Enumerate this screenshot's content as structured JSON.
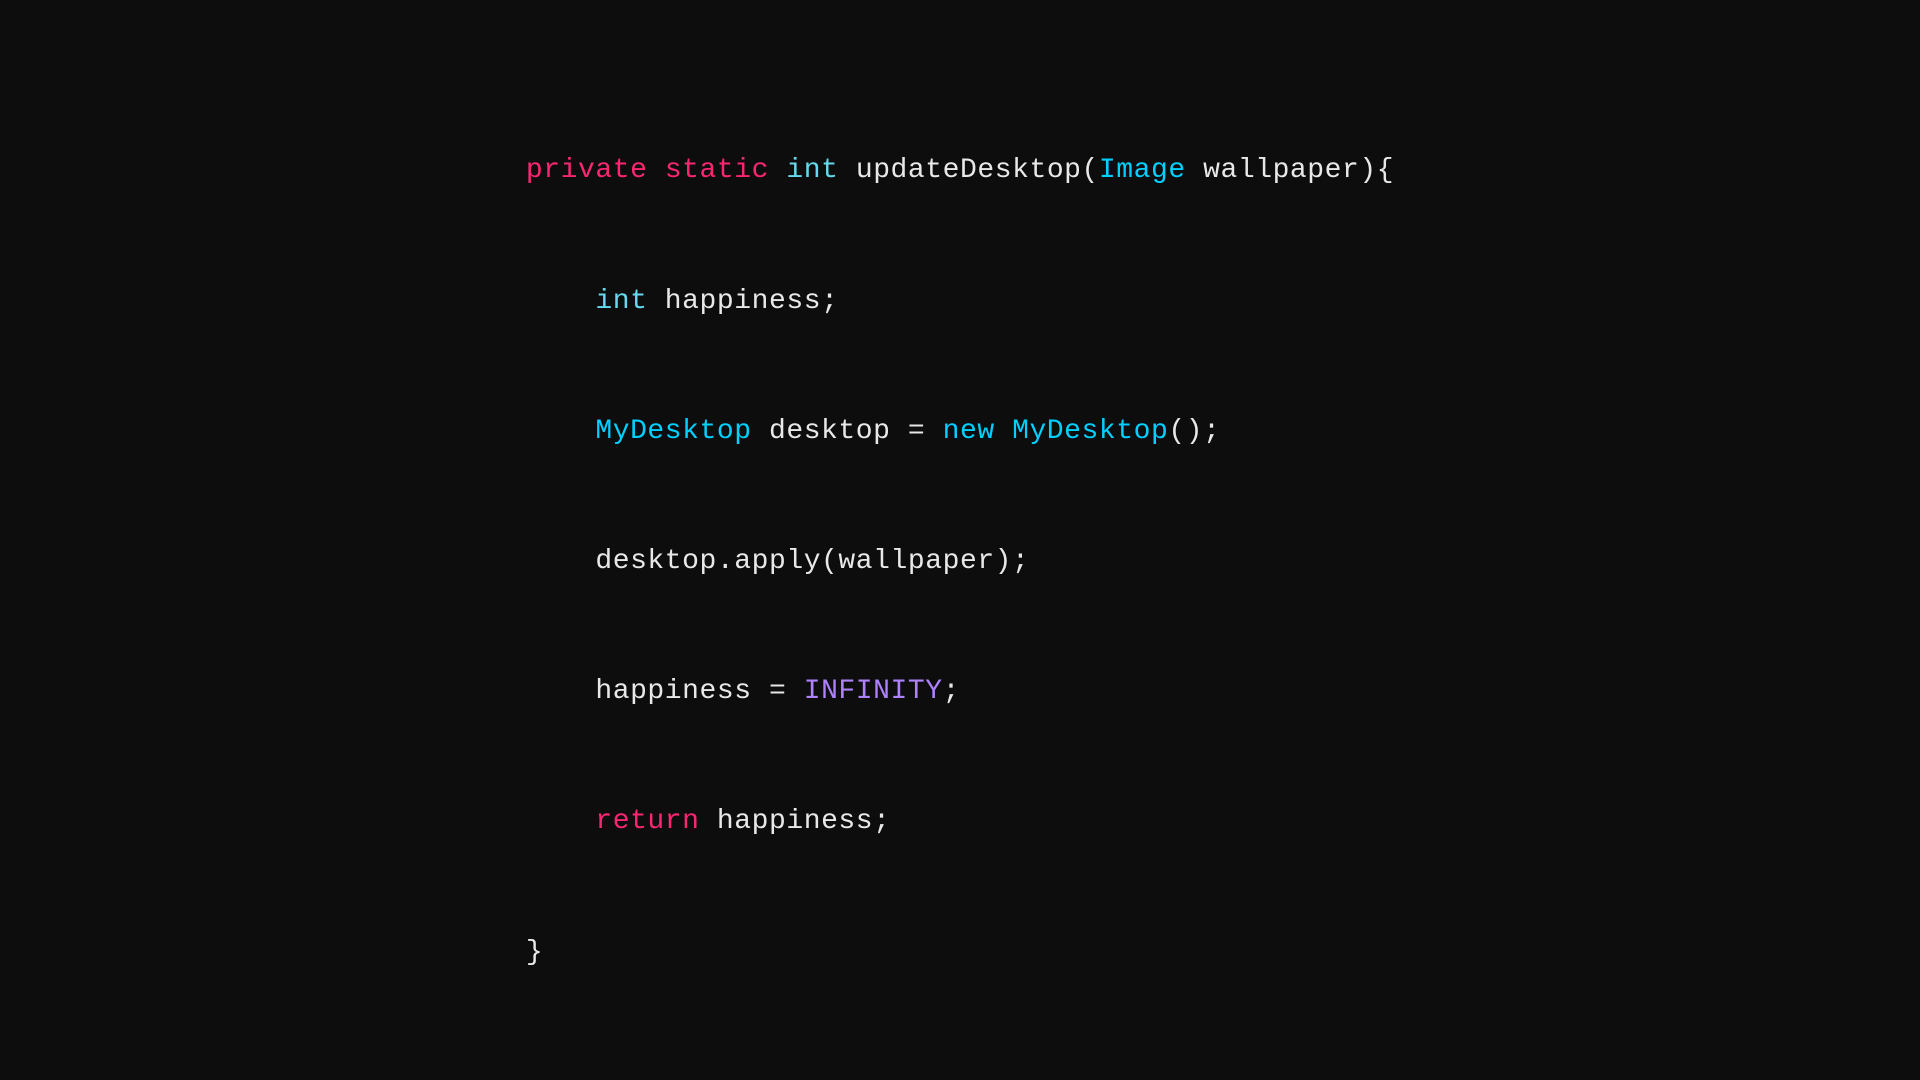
{
  "code": {
    "line1": {
      "private": "private",
      "static": "static",
      "int": "int",
      "rest": " updateDesktop(",
      "image": "Image",
      "wallpaper": " wallpaper){"
    },
    "line2": {
      "int": "int",
      "rest": " happiness;"
    },
    "line3": {
      "mydesktop": "MyDesktop",
      "rest1": " desktop = ",
      "new": "new",
      "rest2": " ",
      "mydesktop2": "MyDesktop",
      "rest3": "();"
    },
    "line4": {
      "text": "desktop.apply(wallpaper);"
    },
    "line5": {
      "text1": "happiness = ",
      "infinity": "INFINITY",
      "text2": ";"
    },
    "line6": {
      "return": "return",
      "text": " happiness;"
    },
    "line7": {
      "text": "}"
    }
  }
}
